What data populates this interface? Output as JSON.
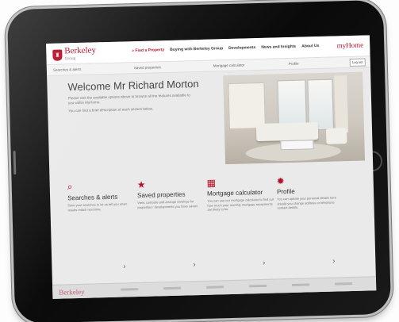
{
  "brand": {
    "name": "Berkeley",
    "sub": "Group",
    "myhome": "myHome",
    "accent": "#b5122a"
  },
  "nav": [
    {
      "label": "Find a Property",
      "icon": "search-icon"
    },
    {
      "label": "Buying with Berkeley Group"
    },
    {
      "label": "Developments"
    },
    {
      "label": "News and Insights"
    },
    {
      "label": "About Us"
    }
  ],
  "subbar": {
    "items": [
      "Searches & alerts",
      "Saved properties",
      "Mortgage calculator",
      "Profile"
    ],
    "logout": "Log out"
  },
  "welcome": {
    "title": "Welcome Mr Richard Morton",
    "intro": "Please visit the available options above to browse all the features available to you within MyHome.",
    "hint": "You can find a brief description of each section below."
  },
  "panels": [
    {
      "icon": "search-icon",
      "title": "Searches & alerts",
      "text": "Save your searches to let us tell you when results match next time."
    },
    {
      "icon": "star-icon",
      "title": "Saved properties",
      "text": "View, compare and arrange viewings for properties / developments you have saved."
    },
    {
      "icon": "calculator-icon",
      "title": "Mortgage calculator",
      "text": "You can use our mortgage calculator to find out how much your monthly mortgage repayments are likely to be."
    },
    {
      "icon": "gear-icon",
      "title": "Profile",
      "text": "You can update your personal details here should you change address or telephone contact details."
    }
  ]
}
